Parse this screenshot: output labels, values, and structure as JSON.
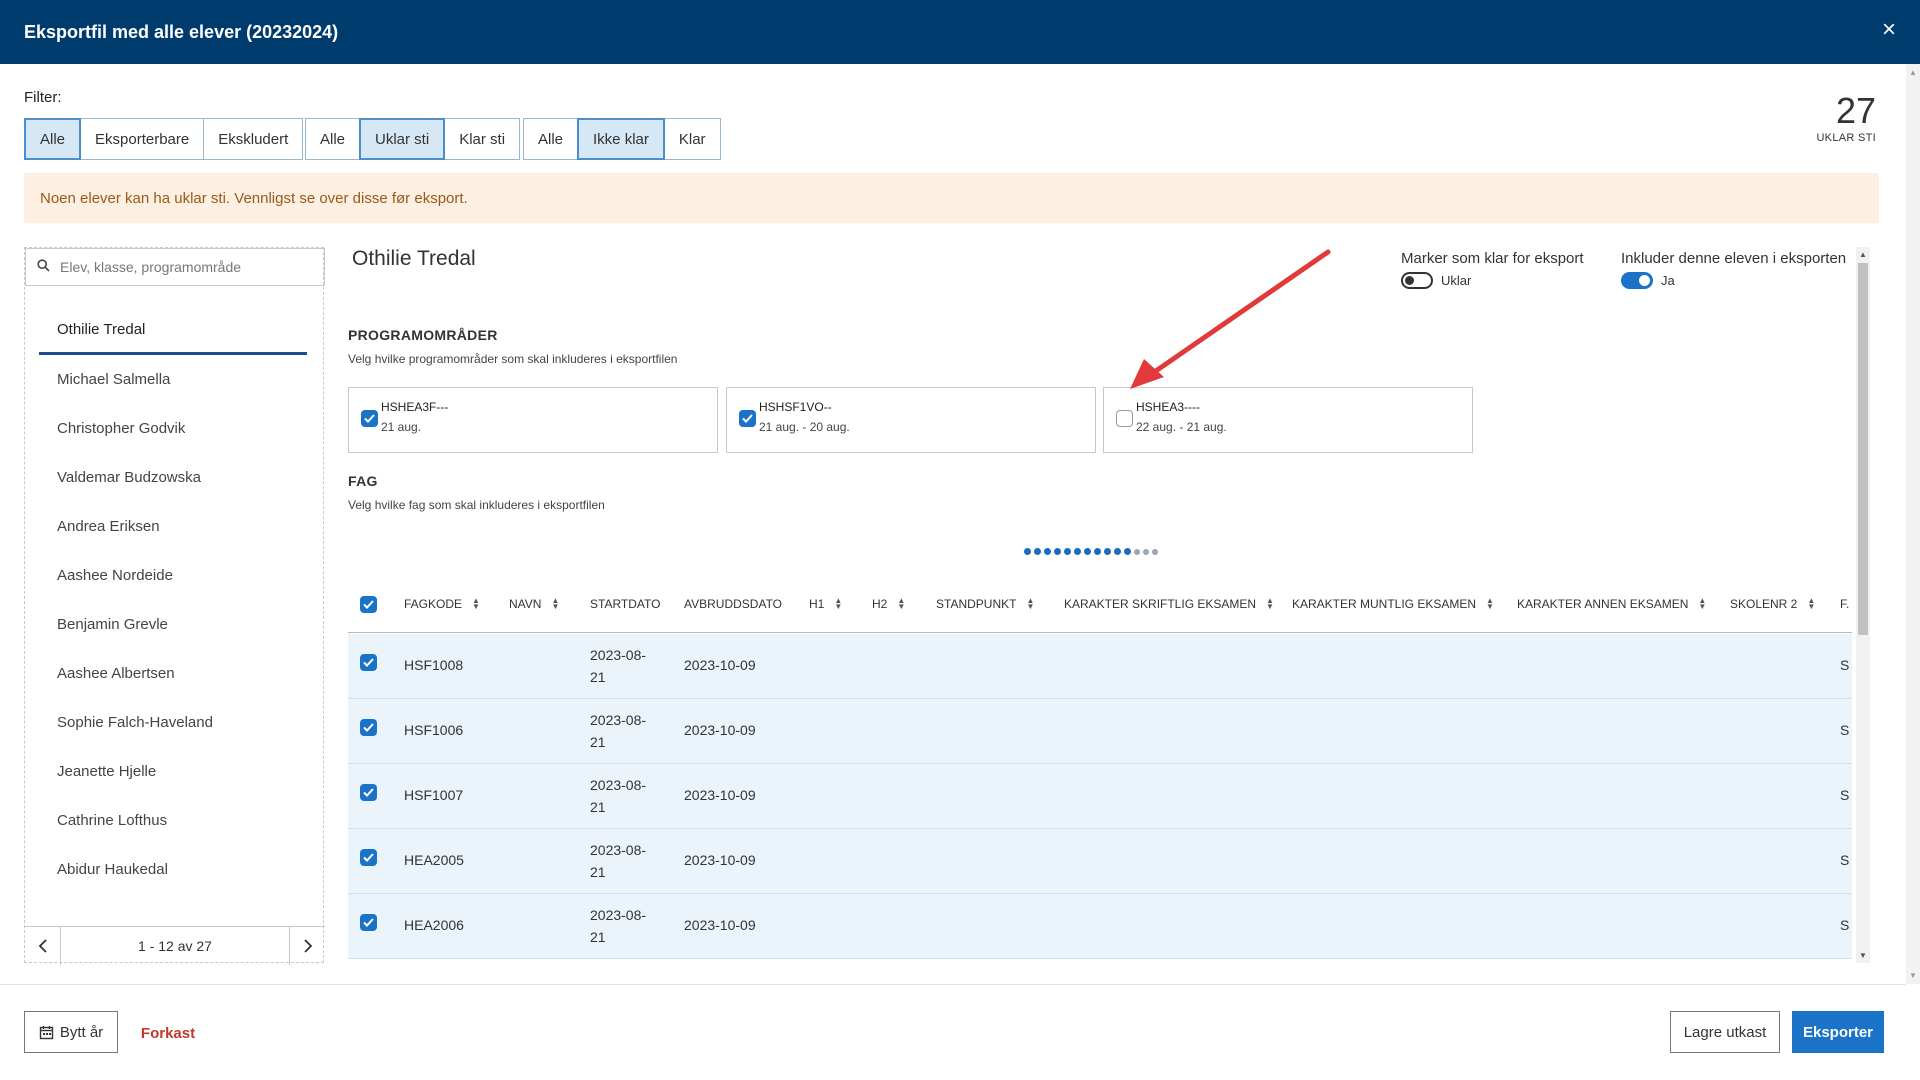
{
  "dialog": {
    "title": "Eksportfil med alle elever (20232024)",
    "close_glyph": "×"
  },
  "filter": {
    "label": "Filter:",
    "group1": [
      "Alle",
      "Eksporterbare",
      "Ekskludert"
    ],
    "group1_active": "Alle",
    "group2": [
      "Alle",
      "Uklar sti",
      "Klar sti"
    ],
    "group2_active": "Uklar sti",
    "group3": [
      "Alle",
      "Ikke klar",
      "Klar"
    ],
    "group3_active": "Ikke klar"
  },
  "counter": {
    "value": "27",
    "label": "UKLAR STI"
  },
  "warning": "Noen elever kan ha uklar sti. Vennligst se over disse før eksport.",
  "search": {
    "placeholder": "Elev, klasse, programområde"
  },
  "students": [
    "Othilie Tredal",
    "Michael Salmella",
    "Christopher Godvik",
    "Valdemar Budzowska",
    "Andrea Eriksen",
    "Aashee Nordeide",
    "Benjamin Grevle",
    "Aashee Albertsen",
    "Sophie Falch-Haveland",
    "Jeanette Hjelle",
    "Cathrine Lofthus",
    "Abidur Haukedal"
  ],
  "pager": {
    "text": "1 - 12  av 27"
  },
  "detail": {
    "student_name": "Othilie Tredal",
    "ready_toggle": {
      "label": "Marker som klar for eksport",
      "value": "Uklar",
      "on": false
    },
    "include_toggle": {
      "label": "Inkluder denne eleven i eksporten",
      "value": "Ja",
      "on": true
    },
    "programs_title": "PROGRAMOMRÅDER",
    "programs_sub": "Velg hvilke programområder som skal inkluderes i eksportfilen",
    "programs": [
      {
        "code": "HSHEA3F---",
        "dates": "21 aug.",
        "checked": true
      },
      {
        "code": "HSHSF1VO--",
        "dates": "21 aug. - 20 aug.",
        "checked": true
      },
      {
        "code": "HSHEA3----",
        "dates": "22 aug. - 21 aug.",
        "checked": false
      }
    ],
    "fag_title": "FAG",
    "fag_sub": "Velg hvilke fag som skal inkluderes i eksportfilen"
  },
  "table": {
    "headers": [
      "FAGKODE",
      "NAVN",
      "STARTDATO",
      "AVBRUDDSDATO",
      "H1",
      "H2",
      "STANDPUNKT",
      "KARAKTER SKRIFTLIG EKSAMEN",
      "KARAKTER MUNTLIG EKSAMEN",
      "KARAKTER ANNEN EKSAMEN",
      "SKOLENR 2",
      "F."
    ],
    "rows": [
      {
        "fagkode": "HSF1008",
        "start_a": "2023-08-",
        "start_b": "21",
        "avbrudd": "2023-10-09",
        "last": "S"
      },
      {
        "fagkode": "HSF1006",
        "start_a": "2023-08-",
        "start_b": "21",
        "avbrudd": "2023-10-09",
        "last": "S"
      },
      {
        "fagkode": "HSF1007",
        "start_a": "2023-08-",
        "start_b": "21",
        "avbrudd": "2023-10-09",
        "last": "S"
      },
      {
        "fagkode": "HEA2005",
        "start_a": "2023-08-",
        "start_b": "21",
        "avbrudd": "2023-10-09",
        "last": "S"
      },
      {
        "fagkode": "HEA2006",
        "start_a": "2023-08-",
        "start_b": "21",
        "avbrudd": "2023-10-09",
        "last": "S"
      }
    ]
  },
  "footer": {
    "change_year": "Bytt år",
    "discard": "Forkast",
    "save_draft": "Lagre utkast",
    "export": "Eksporter"
  },
  "colors": {
    "header_bg": "#003b6e",
    "accent": "#1a73c7",
    "warning_bg": "#fdf0e3",
    "warning_text": "#9a5a17",
    "row_bg": "#ebf3fb",
    "discard": "#c0392b"
  },
  "icons": {
    "search": "search-icon",
    "close": "close-icon",
    "calendar": "calendar-icon",
    "prev": "chevron-left-icon",
    "next": "chevron-right-icon",
    "sort": "sort-icon"
  }
}
